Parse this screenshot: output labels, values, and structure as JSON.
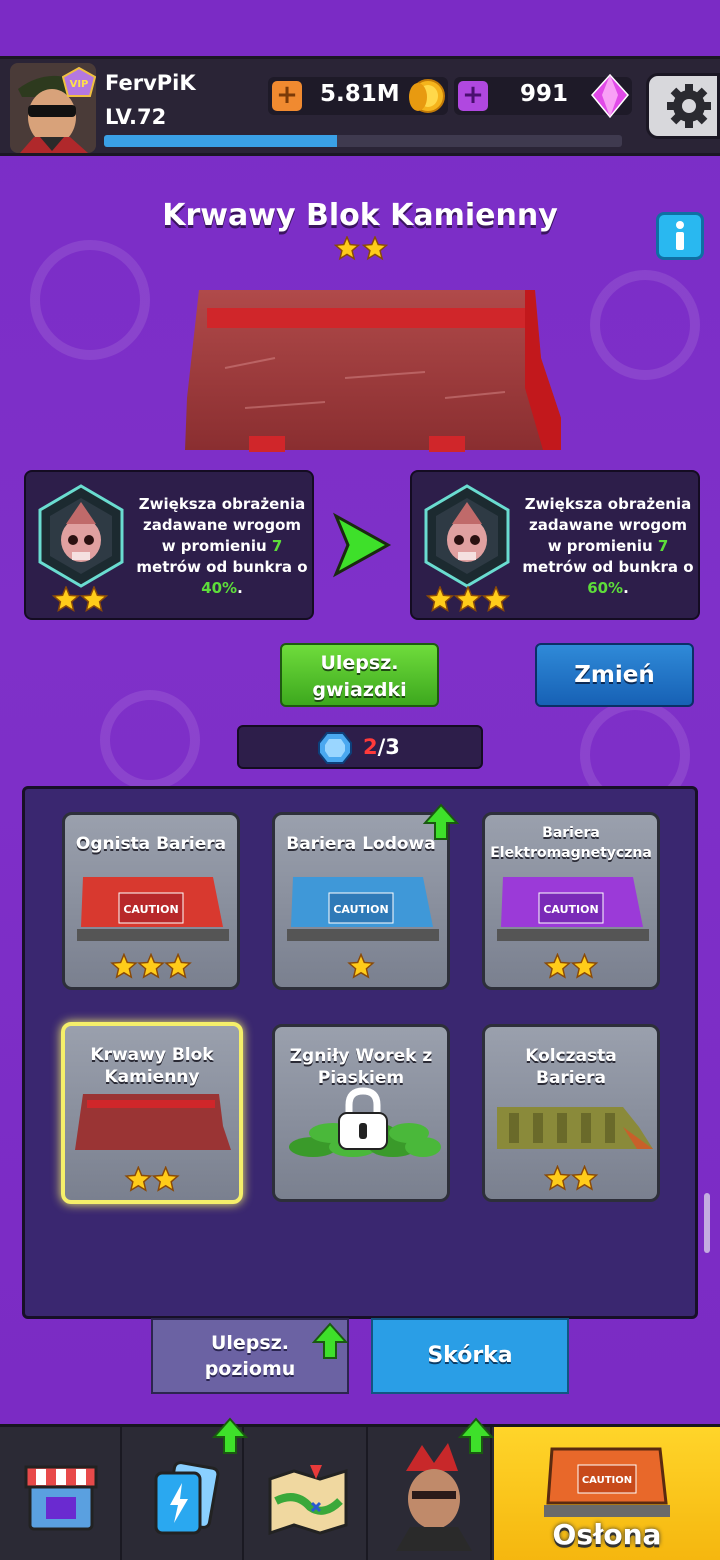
{
  "header": {
    "player_name": "FervPiK",
    "level": "LV.72",
    "xp_fraction": 0.45,
    "vip_label": "VIP",
    "coins": "5.81M",
    "gems": "991"
  },
  "item": {
    "title": "Krwawy Blok Kamienny",
    "stars": 2
  },
  "effects": {
    "current": {
      "line1": "Zwiększa obrażenia",
      "line2": "zadawane wrogom",
      "line3_a": "w promieniu ",
      "radius": "7",
      "line4": "metrów od bunkra o",
      "percent": "40%",
      "dot": ".",
      "stars": 2
    },
    "next": {
      "line1": "Zwiększa obrażenia",
      "line2": "zadawane wrogom",
      "line3_a": "w promieniu ",
      "radius": "7",
      "line4": "metrów od bunkra o",
      "percent": "60%",
      "dot": ".",
      "stars": 3
    }
  },
  "buttons": {
    "upgrade_stars_line1": "Ulepsz.",
    "upgrade_stars_line2": "gwiazdki",
    "change": "Zmień"
  },
  "counter": {
    "have": "2",
    "total": "/3"
  },
  "barriers": [
    {
      "name": "Ognista Bariera",
      "stars": 3,
      "color": "#d8392f"
    },
    {
      "name": "Bariera Lodowa",
      "stars": 1,
      "color": "#3f98d8"
    },
    {
      "name_line1": "Bariera",
      "name_line2": "Elektromagnetyczna",
      "stars": 2,
      "color": "#9b3ad8"
    },
    {
      "name_line1": "Krwawy Blok",
      "name_line2": "Kamienny",
      "stars": 2,
      "selected": true
    },
    {
      "name_line1": "Zgniły Worek z",
      "name_line2": "Piaskiem",
      "locked": true
    },
    {
      "name_line1": "Kolczasta",
      "name_line2": "Bariera",
      "stars": 2
    }
  ],
  "caution_label": "CAUTION",
  "tabs": {
    "upgrade_level_line1": "Ulepsz.",
    "upgrade_level_line2": "poziomu",
    "skin": "Skórka"
  },
  "nav": {
    "cover": "Osłona"
  },
  "colors": {
    "background": "#7a2bc4",
    "header": "#2a2436",
    "green_button": "#4cc02a",
    "blue_button": "#1f72c6",
    "active_tab": "#ffd52a"
  }
}
